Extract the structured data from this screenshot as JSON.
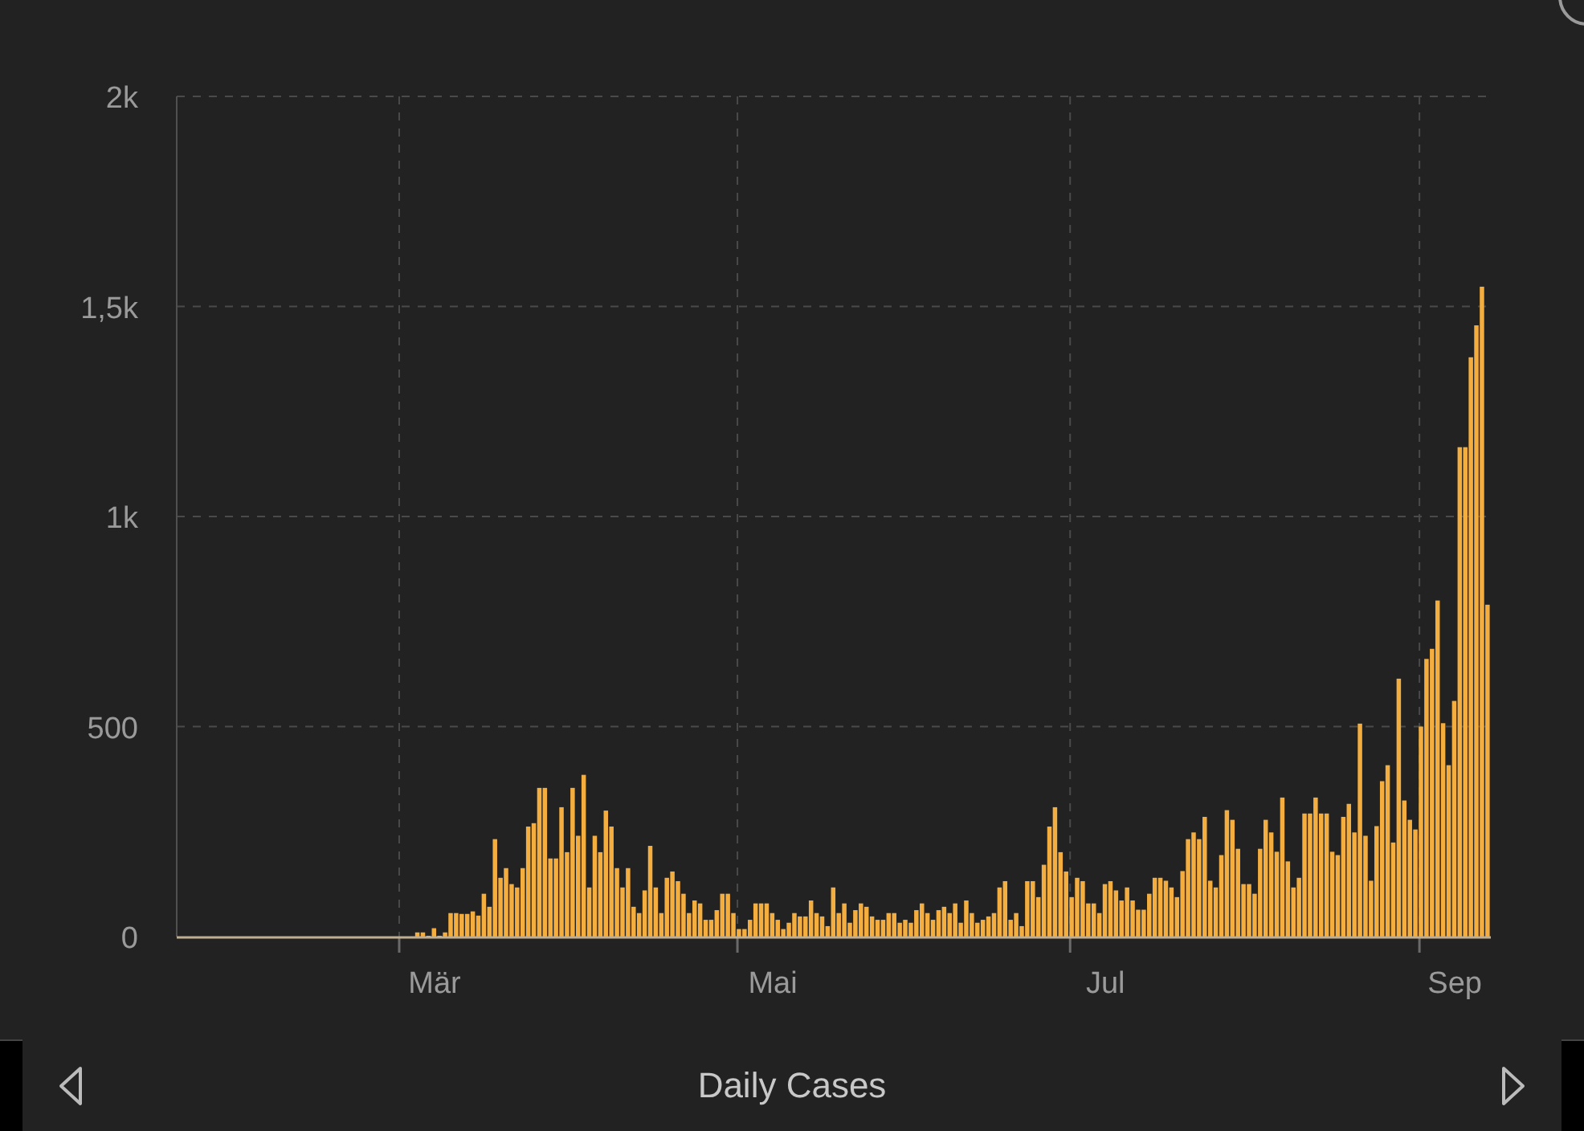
{
  "chart": {
    "chart_data": {
      "type": "bar",
      "grid": true,
      "ylim": [
        0,
        2000
      ],
      "categories": [
        null,
        null,
        null,
        null,
        null,
        null,
        null,
        null,
        null,
        null,
        null,
        null,
        null,
        null,
        null,
        null,
        null,
        null,
        null,
        null,
        null,
        null,
        null,
        null,
        null,
        null,
        null,
        null,
        null,
        null,
        null,
        null,
        null,
        null,
        null,
        null,
        null,
        null,
        null,
        null,
        null,
        null,
        null,
        null,
        null,
        null,
        "Mär",
        null,
        null,
        null,
        null,
        null,
        null,
        null,
        null,
        null,
        null,
        null,
        null,
        null,
        null,
        null,
        null,
        null,
        null,
        null,
        null,
        null,
        null,
        null,
        null,
        null,
        null,
        null,
        null,
        null,
        null,
        null,
        null,
        null,
        null,
        null,
        null,
        null,
        null,
        null,
        null,
        null,
        null,
        null,
        null,
        null,
        null,
        null,
        null,
        null,
        null,
        null,
        null,
        null,
        null,
        null,
        null,
        null,
        null,
        null,
        null,
        "Mai",
        null,
        null,
        null,
        null,
        null,
        null,
        null,
        null,
        null,
        null,
        null,
        null,
        null,
        null,
        null,
        null,
        null,
        null,
        null,
        null,
        null,
        null,
        null,
        null,
        null,
        null,
        null,
        null,
        null,
        null,
        null,
        null,
        null,
        null,
        null,
        null,
        null,
        null,
        null,
        null,
        null,
        null,
        null,
        null,
        null,
        null,
        null,
        null,
        null,
        null,
        null,
        null,
        null,
        null,
        null,
        null,
        null,
        null,
        null,
        "Jul",
        null,
        null,
        null,
        null,
        null,
        null,
        null,
        null,
        null,
        null,
        null,
        null,
        null,
        null,
        null,
        null,
        null,
        null,
        null,
        null,
        null,
        null,
        null,
        null,
        null,
        null,
        null,
        null,
        null,
        null,
        null,
        null,
        null,
        null,
        null,
        null,
        null,
        null,
        null,
        null,
        null,
        null,
        null,
        null,
        null,
        null,
        null,
        null,
        null,
        null,
        null,
        null,
        null,
        null,
        null,
        null,
        null,
        null,
        null,
        null,
        null,
        null,
        "Sep",
        null,
        null,
        null,
        null,
        null,
        null
      ],
      "yticks": [
        {
          "value": 0,
          "label": "0"
        },
        {
          "value": 500,
          "label": "500"
        },
        {
          "value": 1000,
          "label": "1k"
        },
        {
          "value": 1500,
          "label": "1,5k"
        },
        {
          "value": 2000,
          "label": "2k"
        }
      ],
      "series": [
        {
          "color": "#f3ae3f",
          "values": [
            0,
            0,
            0,
            0,
            0,
            0,
            0,
            0,
            0,
            0,
            0,
            0,
            0,
            0,
            0,
            0,
            0,
            0,
            0,
            0,
            0,
            0,
            0,
            0,
            0,
            0,
            0,
            0,
            0,
            0,
            0,
            0,
            0,
            0,
            0,
            0,
            0,
            0,
            0,
            0,
            0,
            0,
            0,
            10,
            10,
            2,
            20,
            2,
            10,
            56,
            56,
            54,
            54,
            60,
            50,
            102,
            71,
            232,
            140,
            163,
            125,
            117,
            163,
            262,
            270,
            354,
            354,
            186,
            186,
            308,
            201,
            354,
            240,
            385,
            117,
            240,
            201,
            300,
            262,
            163,
            117,
            163,
            71,
            56,
            110,
            216,
            117,
            56,
            140,
            155,
            132,
            102,
            56,
            86,
            79,
            40,
            40,
            63,
            102,
            102,
            56,
            18,
            18,
            40,
            79,
            79,
            79,
            56,
            40,
            18,
            33,
            56,
            48,
            48,
            86,
            56,
            48,
            25,
            117,
            56,
            79,
            33,
            63,
            79,
            71,
            48,
            40,
            40,
            56,
            56,
            33,
            40,
            33,
            63,
            79,
            56,
            40,
            63,
            71,
            56,
            79,
            33,
            86,
            56,
            33,
            40,
            48,
            56,
            117,
            132,
            40,
            56,
            25,
            132,
            132,
            94,
            171,
            262,
            308,
            201,
            155,
            94,
            140,
            132,
            79,
            79,
            56,
            125,
            132,
            110,
            86,
            117,
            86,
            64,
            64,
            102,
            140,
            140,
            133,
            117,
            94,
            156,
            232,
            248,
            232,
            285,
            133,
            117,
            194,
            301,
            278,
            209,
            125,
            125,
            102,
            209,
            278,
            248,
            202,
            331,
            179,
            117,
            140,
            293,
            293,
            331,
            293,
            293,
            202,
            194,
            285,
            316,
            248,
            507,
            240,
            133,
            263,
            370,
            408,
            224,
            614,
            324,
            278,
            255,
            500,
            661,
            685,
            800,
            508,
            408,
            561,
            1165,
            1165,
            1379,
            1455,
            1547,
            790
          ]
        }
      ]
    }
  },
  "footer": {
    "title": "Daily Cases"
  }
}
